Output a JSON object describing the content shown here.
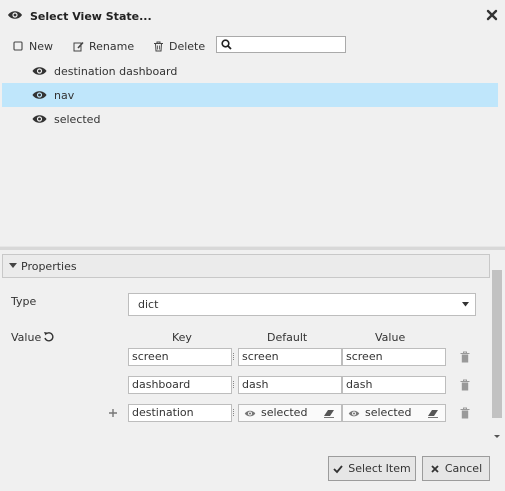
{
  "dialog": {
    "title": "Select View State..."
  },
  "toolbar": {
    "new_label": "New",
    "rename_label": "Rename",
    "delete_label": "Delete",
    "search": {
      "value": "",
      "placeholder": ""
    }
  },
  "states": [
    {
      "label": "destination dashboard",
      "selected": false
    },
    {
      "label": "nav",
      "selected": true
    },
    {
      "label": "selected",
      "selected": false
    }
  ],
  "properties": {
    "header": "Properties",
    "type_label": "Type",
    "type_value": "dict",
    "value_label": "Value",
    "columns": {
      "key": "Key",
      "default": "Default",
      "value": "Value"
    },
    "rows": [
      {
        "key": "screen",
        "default": "screen",
        "value": "screen"
      },
      {
        "key": "dashboard",
        "default": "dash",
        "value": "dash"
      },
      {
        "key": "destination",
        "default": "selected",
        "value": "selected"
      }
    ]
  },
  "buttons": {
    "select": "Select Item",
    "cancel": "Cancel"
  },
  "colors": {
    "selection": "#bfe6fb",
    "background": "#f0f0f0"
  }
}
